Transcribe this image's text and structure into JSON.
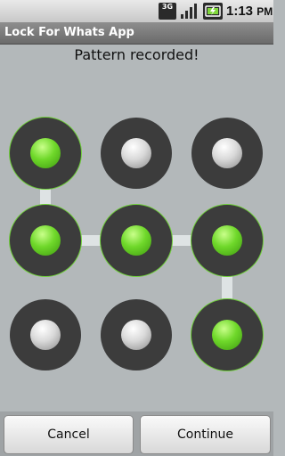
{
  "status_bar": {
    "network": "3G",
    "time": "1:13",
    "time_suffix": "PM",
    "icons": [
      "network-3g-icon",
      "signal-icon",
      "battery-charging-icon"
    ]
  },
  "header": {
    "title": "Lock For Whats App"
  },
  "message": "Pattern recorded!",
  "pattern": {
    "grid": "3x3",
    "selected_sequence": [
      1,
      4,
      5,
      6,
      9
    ],
    "nodes": [
      1,
      2,
      3,
      4,
      5,
      6,
      7,
      8,
      9
    ]
  },
  "buttons": {
    "cancel": "Cancel",
    "continue": "Continue"
  },
  "colors": {
    "active": "#6fd82a",
    "node_ring": "#3c3c3c",
    "background": "#b3b8ba"
  }
}
